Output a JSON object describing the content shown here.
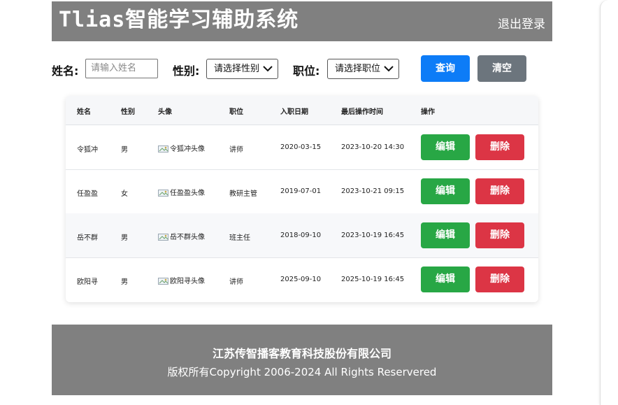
{
  "header": {
    "title": "Tlias智能学习辅助系统",
    "logout": "退出登录"
  },
  "search": {
    "name_label": "姓名:",
    "name_placeholder": "请输入姓名",
    "gender_label": "性别:",
    "gender_value": "请选择性别",
    "position_label": "职位:",
    "position_value": "请选择职位",
    "query_button": "查询",
    "clear_button": "清空"
  },
  "table": {
    "headers": [
      "姓名",
      "性别",
      "头像",
      "职位",
      "入职日期",
      "最后操作时间",
      "操作"
    ],
    "rows": [
      {
        "name": "令狐冲",
        "gender": "男",
        "avatar": "令狐冲头像",
        "position": "讲师",
        "entry_date": "2020-03-15",
        "last_op": "2023-10-20 14:30",
        "edit": "编辑",
        "delete": "删除"
      },
      {
        "name": "任盈盈",
        "gender": "女",
        "avatar": "任盈盈头像",
        "position": "教研主管",
        "entry_date": "2019-07-01",
        "last_op": "2023-10-21 09:15",
        "edit": "编辑",
        "delete": "删除"
      },
      {
        "name": "岳不群",
        "gender": "男",
        "avatar": "岳不群头像",
        "position": "班主任",
        "entry_date": "2018-09-10",
        "last_op": "2023-10-19 16:45",
        "edit": "编辑",
        "delete": "删除"
      },
      {
        "name": "欧阳寻",
        "gender": "男",
        "avatar": "欧阳寻头像",
        "position": "讲师",
        "entry_date": "2025-09-10",
        "last_op": "2025-10-19 16:45",
        "edit": "编辑",
        "delete": "删除"
      }
    ]
  },
  "footer": {
    "company": "江苏传智播客教育科技股份有限公司",
    "copyright": "版权所有Copyright 2006-2024 All Rights Reservered"
  },
  "colors": {
    "header_bg": "#808080",
    "query": "#0d7cf7",
    "clear": "#6c757d",
    "edit": "#28a745",
    "delete": "#dc3545"
  }
}
